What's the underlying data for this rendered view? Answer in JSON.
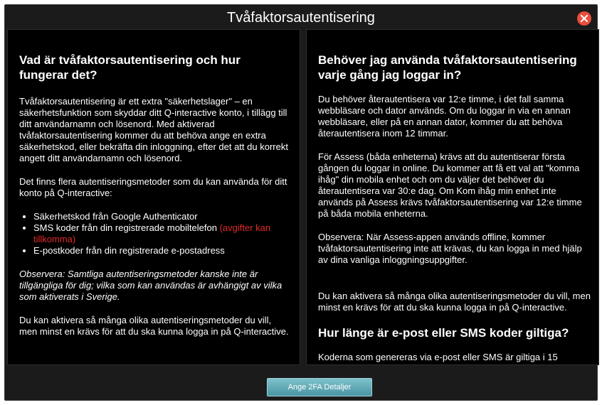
{
  "dialog": {
    "title": "Tvåfaktorsautentisering"
  },
  "left": {
    "heading": "Vad är tvåfaktorsautentisering och hur fungerar det?",
    "p1": "Tvåfaktorsautentisering är ett extra \"säkerhetslager\" – en säkerhetsfunktion som skyddar ditt Q-interactive konto, i tillägg till ditt användarnamn och lösenord. Med aktiverad tvåfaktorsautentisering kommer du att behöva ange en extra säkerhetskod, eller bekräfta din inloggning, efter det att du korrekt angett ditt användarnamn och lösenord.",
    "p2": "Det finns flera autentiseringsmetoder som du kan använda för ditt konto på Q-interactive:",
    "methods": {
      "m1": "Säkerhetskod från Google Authenticator",
      "m2": "SMS koder från din registrerade mobiltelefon",
      "m2_note": "(avgifter kan tillkomma)",
      "m3": "E-postkoder från din registrerade e-postadress"
    },
    "note": "Observera: Samtliga autentiseringsmetoder kanske inte är tillgängliga för dig; vilka som kan användas är avhängigt av vilka som aktiverats i Sverige.",
    "p3": "Du kan aktivera så många olika autentiseringsmetoder du vill, men minst en krävs för att du ska kunna logga in på Q-interactive."
  },
  "right": {
    "heading": "Behöver jag använda tvåfaktorsautentisering varje gång jag loggar in?",
    "p1": "Du behöver återautentisera var 12:e timme, i det fall samma webbläsare och dator används. Om du loggar in via en annan webbläsare, eller på en annan dator, kommer du att behöva återautentisera inom 12 timmar.",
    "p2": "För Assess (båda enheterna) krävs att du autentiserar första gången du loggar in online. Du kommer att få ett val att \"komma ihåg\" din mobila enhet och om du väljer det behöver du återautentisera var 30:e dag. Om Kom ihåg min enhet inte används på Assess krävs tvåfaktorsautentisering var 12:e timme på båda mobila enheterna.",
    "p3": "Observera: När Assess-appen används offline, kommer tvåfaktorsautentisering inte att krävas, du kan logga in med hjälp av dina vanliga inloggningsuppgifter.",
    "p4": "Du kan aktivera så många olika autentiseringsmetoder du vill, men minst en krävs för att du ska kunna logga in på Q-interactive.",
    "heading2": "Hur länge är e-post eller SMS koder giltiga?",
    "p5": "Koderna som genereras via e-post eller SMS är giltiga i 15"
  },
  "footer": {
    "button_label": "Ange 2FA Detaljer"
  },
  "colors": {
    "dialog_bg": "#1b1b1b",
    "panel_bg": "#000000",
    "close": "#e84f3c",
    "warning_text": "#e12a2a",
    "button_top": "#7ec2cb",
    "button_bottom": "#4a95a3"
  }
}
